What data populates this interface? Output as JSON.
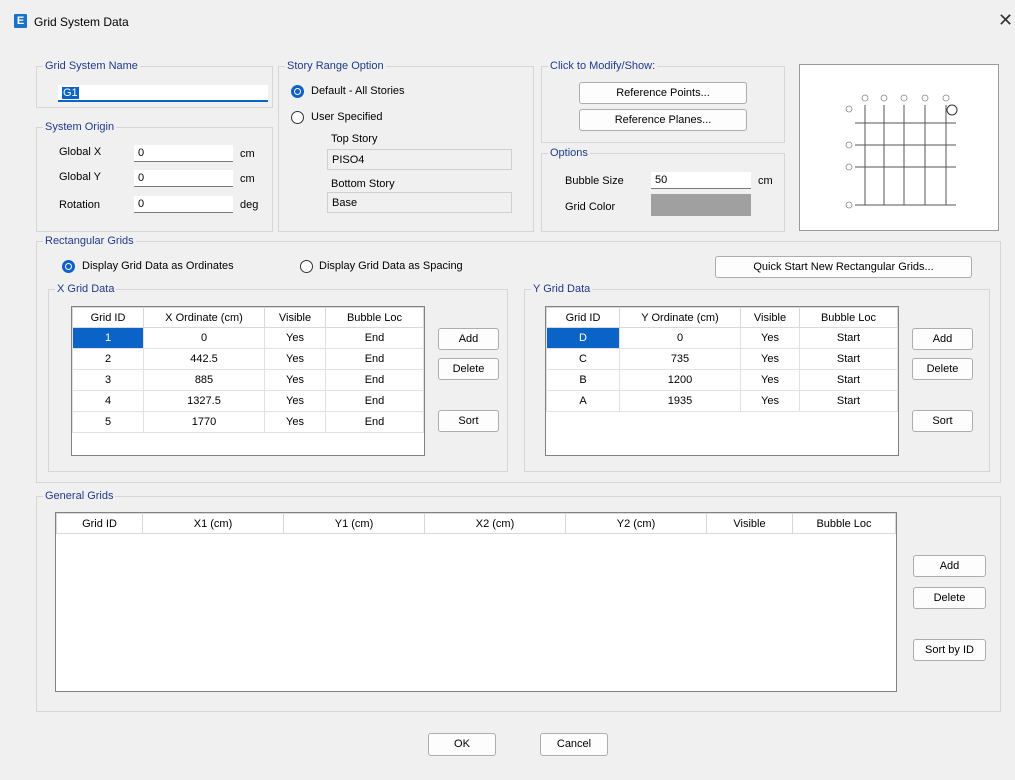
{
  "window": {
    "title": "Grid System Data",
    "app_icon": "E"
  },
  "grid_system_name": {
    "legend": "Grid System Name",
    "value": "G1"
  },
  "system_origin": {
    "legend": "System Origin",
    "global_x": {
      "label": "Global X",
      "value": "0",
      "unit": "cm"
    },
    "global_y": {
      "label": "Global Y",
      "value": "0",
      "unit": "cm"
    },
    "rotation": {
      "label": "Rotation",
      "value": "0",
      "unit": "deg"
    }
  },
  "story_range": {
    "legend": "Story Range Option",
    "default_label": "Default - All Stories",
    "user_label": "User Specified",
    "top_story_label": "Top Story",
    "top_story_value": "PISO4",
    "bottom_story_label": "Bottom Story",
    "bottom_story_value": "Base"
  },
  "modify_show": {
    "legend": "Click to Modify/Show:",
    "reference_points": "Reference Points...",
    "reference_planes": "Reference Planes..."
  },
  "options": {
    "legend": "Options",
    "bubble_size_label": "Bubble Size",
    "bubble_size_value": "50",
    "bubble_size_unit": "cm",
    "grid_color_label": "Grid Color",
    "grid_color": "#a0a0a0"
  },
  "rectangular_grids": {
    "legend": "Rectangular Grids",
    "ordinates_label": "Display Grid Data as Ordinates",
    "spacing_label": "Display Grid Data as Spacing",
    "quick_start": "Quick Start New Rectangular Grids..."
  },
  "x_grid": {
    "legend": "X Grid Data",
    "headers": [
      "Grid ID",
      "X Ordinate (cm)",
      "Visible",
      "Bubble Loc"
    ],
    "rows": [
      [
        "1",
        "0",
        "Yes",
        "End"
      ],
      [
        "2",
        "442.5",
        "Yes",
        "End"
      ],
      [
        "3",
        "885",
        "Yes",
        "End"
      ],
      [
        "4",
        "1327.5",
        "Yes",
        "End"
      ],
      [
        "5",
        "1770",
        "Yes",
        "End"
      ]
    ],
    "add": "Add",
    "delete": "Delete",
    "sort": "Sort"
  },
  "y_grid": {
    "legend": "Y Grid Data",
    "headers": [
      "Grid ID",
      "Y Ordinate (cm)",
      "Visible",
      "Bubble Loc"
    ],
    "rows": [
      [
        "D",
        "0",
        "Yes",
        "Start"
      ],
      [
        "C",
        "735",
        "Yes",
        "Start"
      ],
      [
        "B",
        "1200",
        "Yes",
        "Start"
      ],
      [
        "A",
        "1935",
        "Yes",
        "Start"
      ]
    ],
    "add": "Add",
    "delete": "Delete",
    "sort": "Sort"
  },
  "general_grids": {
    "legend": "General Grids",
    "headers": [
      "Grid ID",
      "X1 (cm)",
      "Y1 (cm)",
      "X2 (cm)",
      "Y2 (cm)",
      "Visible",
      "Bubble Loc"
    ],
    "add": "Add",
    "delete": "Delete",
    "sort": "Sort by ID"
  },
  "footer": {
    "ok": "OK",
    "cancel": "Cancel"
  },
  "accent_color": "#0a64c8",
  "legend_color": "#1e3a8a"
}
